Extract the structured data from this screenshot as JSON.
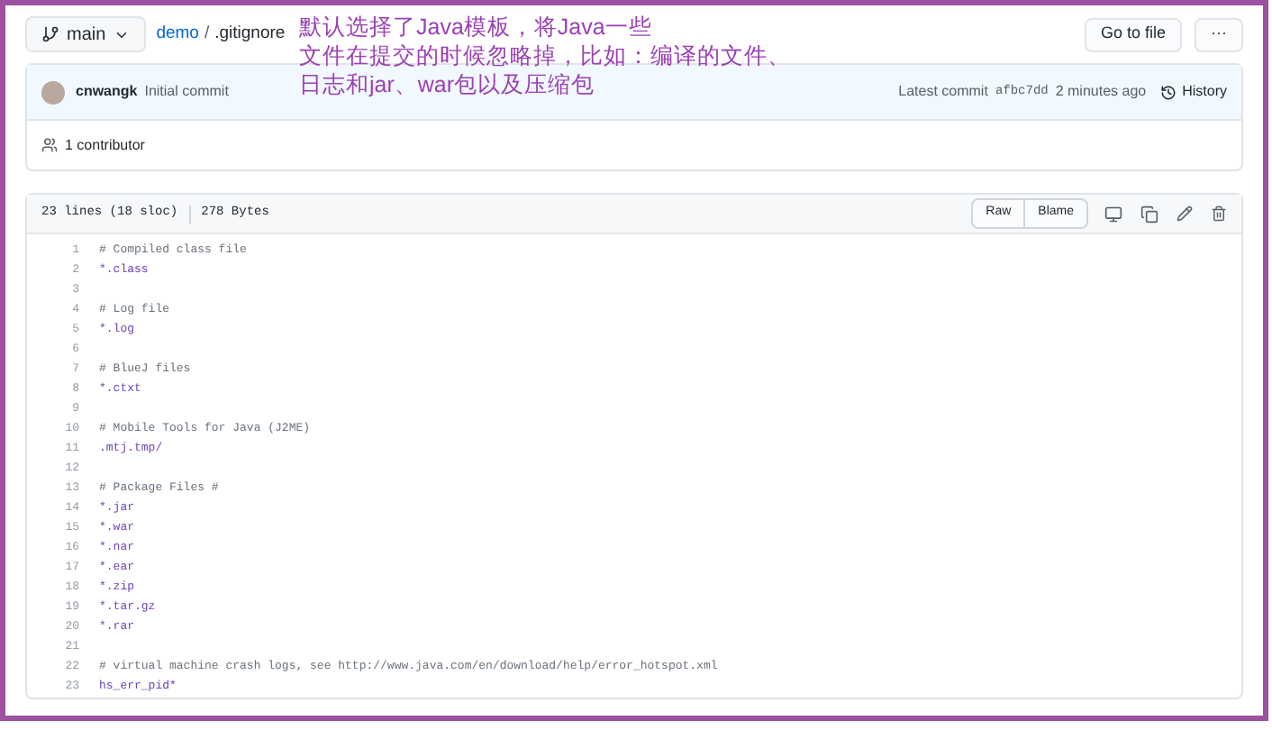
{
  "branch": "main",
  "breadcrumb": {
    "repo": "demo",
    "separator": "/",
    "file": ".gitignore"
  },
  "annotation": [
    "默认选择了Java模板，将Java一些",
    "文件在提交的时候忽略掉，比如：编译的文件、",
    "日志和jar、war包以及压缩包"
  ],
  "actions": {
    "go_to_file": "Go to file",
    "more": "···"
  },
  "commit": {
    "author": "cnwangk",
    "message": "Initial commit",
    "latest_label": "Latest commit",
    "sha": "afbc7dd",
    "time": "2 minutes ago",
    "history": "History"
  },
  "contributors": "1 contributor",
  "file_info": {
    "lines": "23 lines (18 sloc)",
    "size": "278 Bytes"
  },
  "file_buttons": [
    "Raw",
    "Blame"
  ],
  "code": [
    {
      "number": "1",
      "kind": "comment",
      "text": "# Compiled class file"
    },
    {
      "number": "2",
      "kind": "pattern",
      "text": "*.class"
    },
    {
      "number": "3",
      "kind": "blank"
    },
    {
      "number": "4",
      "kind": "comment",
      "text": "# Log file"
    },
    {
      "number": "5",
      "kind": "pattern",
      "text": "*.log"
    },
    {
      "number": "6",
      "kind": "blank"
    },
    {
      "number": "7",
      "kind": "comment",
      "text": "# BlueJ files"
    },
    {
      "number": "8",
      "kind": "pattern",
      "text": "*.ctxt"
    },
    {
      "number": "9",
      "kind": "blank"
    },
    {
      "number": "10",
      "kind": "comment",
      "text": "# Mobile Tools for Java (J2ME)"
    },
    {
      "number": "11",
      "kind": "pattern",
      "text": ".mtj.tmp/"
    },
    {
      "number": "12",
      "kind": "blank"
    },
    {
      "number": "13",
      "kind": "comment",
      "text": "# Package Files #"
    },
    {
      "number": "14",
      "kind": "pattern",
      "text": "*.jar"
    },
    {
      "number": "15",
      "kind": "pattern",
      "text": "*.war"
    },
    {
      "number": "16",
      "kind": "pattern",
      "text": "*.nar"
    },
    {
      "number": "17",
      "kind": "pattern",
      "text": "*.ear"
    },
    {
      "number": "18",
      "kind": "pattern",
      "text": "*.zip"
    },
    {
      "number": "19",
      "kind": "pattern",
      "text": "*.tar.gz"
    },
    {
      "number": "20",
      "kind": "pattern",
      "text": "*.rar"
    },
    {
      "number": "21",
      "kind": "blank"
    },
    {
      "number": "22",
      "kind": "comment",
      "text": "# virtual machine crash logs, see http://www.java.com/en/download/help/error_hotspot.xml"
    },
    {
      "number": "23",
      "kind": "pattern",
      "text": "hs_err_pid*"
    }
  ]
}
